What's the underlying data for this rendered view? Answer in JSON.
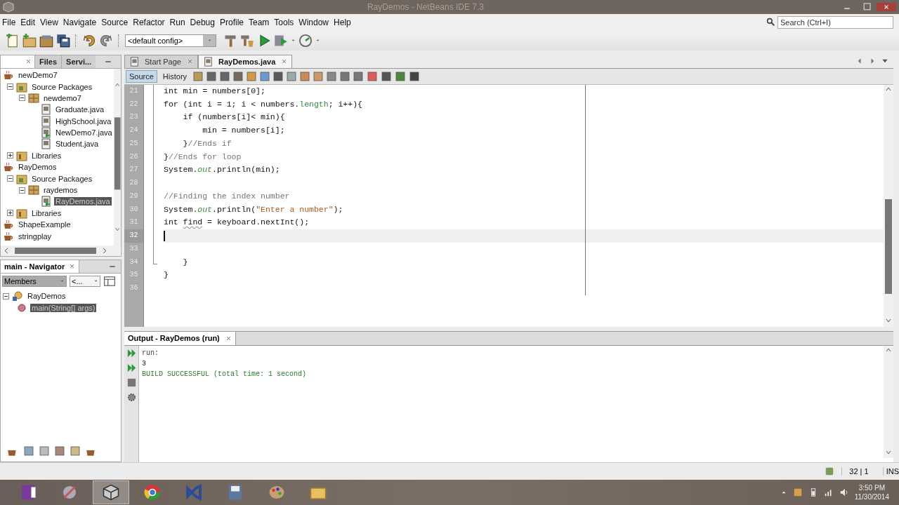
{
  "window": {
    "title": "RayDemos - NetBeans IDE 7.3"
  },
  "menu": [
    "File",
    "Edit",
    "View",
    "Navigate",
    "Source",
    "Refactor",
    "Run",
    "Debug",
    "Profile",
    "Team",
    "Tools",
    "Window",
    "Help"
  ],
  "search": {
    "placeholder": "Search (Ctrl+I)"
  },
  "toolbar": {
    "config": "<default config>"
  },
  "projects": {
    "tabs": [
      {
        "label": "Files",
        "selected": false
      },
      {
        "label": "Servi...",
        "selected": false
      }
    ],
    "tree": [
      {
        "label": "newDemo7",
        "kind": "project",
        "selected": false,
        "children": [
          {
            "label": "Source Packages",
            "kind": "sources",
            "expanded": true,
            "selected": false,
            "children": [
              {
                "label": "newdemo7",
                "kind": "package",
                "expanded": true,
                "selected": false,
                "children": [
                  {
                    "label": "Graduate.java",
                    "kind": "file",
                    "selected": false
                  },
                  {
                    "label": "HighSchool.java",
                    "kind": "file",
                    "selected": false
                  },
                  {
                    "label": "NewDemo7.java",
                    "kind": "mainfile",
                    "selected": false
                  },
                  {
                    "label": "Student.java",
                    "kind": "file",
                    "selected": false
                  }
                ]
              }
            ]
          },
          {
            "label": "Libraries",
            "kind": "libraries",
            "expanded": false,
            "selected": false
          }
        ]
      },
      {
        "label": "RayDemos",
        "kind": "project",
        "selected": false,
        "children": [
          {
            "label": "Source Packages",
            "kind": "sources",
            "expanded": true,
            "selected": false,
            "children": [
              {
                "label": "raydemos",
                "kind": "package",
                "expanded": true,
                "selected": false,
                "children": [
                  {
                    "label": "RayDemos.java",
                    "kind": "mainfile",
                    "selected": true
                  }
                ]
              }
            ]
          },
          {
            "label": "Libraries",
            "kind": "libraries",
            "expanded": false,
            "selected": false
          }
        ]
      },
      {
        "label": "ShapeExample",
        "kind": "project",
        "selected": false
      },
      {
        "label": "stringplay",
        "kind": "project",
        "selected": false
      }
    ]
  },
  "navigator": {
    "title": "main - Navigator",
    "filter": "Members",
    "view": "<...",
    "tree": [
      {
        "label": "RayDemos",
        "kind": "class",
        "expanded": true,
        "selected": false,
        "children": [
          {
            "label": "main(String[] args)",
            "kind": "method",
            "selected": true
          }
        ]
      }
    ]
  },
  "editor": {
    "tabs": [
      {
        "label": "Start Page",
        "selected": false
      },
      {
        "label": "RayDemos.java",
        "selected": true
      }
    ],
    "views": [
      {
        "label": "Source",
        "selected": true
      },
      {
        "label": "History",
        "selected": false
      }
    ],
    "lines": [
      {
        "number": "21",
        "current": false,
        "tokens": [
          {
            "text": "int min = numbers[0];",
            "kind": "plain"
          }
        ]
      },
      {
        "number": "22",
        "current": false,
        "tokens": [
          {
            "text": "for (int i = 1; i < numbers.",
            "kind": "plain"
          },
          {
            "text": "length",
            "kind": "field"
          },
          {
            "text": "; i++){",
            "kind": "plain"
          }
        ]
      },
      {
        "number": "23",
        "current": false,
        "tokens": [
          {
            "text": "    if (numbers[i]< min){",
            "kind": "plain"
          }
        ]
      },
      {
        "number": "24",
        "current": false,
        "tokens": [
          {
            "text": "        min = numbers[i];",
            "kind": "plain"
          }
        ]
      },
      {
        "number": "25",
        "current": false,
        "tokens": [
          {
            "text": "    }",
            "kind": "plain"
          },
          {
            "text": "//Ends if",
            "kind": "comment"
          }
        ]
      },
      {
        "number": "26",
        "current": false,
        "tokens": [
          {
            "text": "}",
            "kind": "plain"
          },
          {
            "text": "//Ends for loop",
            "kind": "comment"
          }
        ]
      },
      {
        "number": "27",
        "current": false,
        "tokens": [
          {
            "text": "System.",
            "kind": "plain"
          },
          {
            "text": "out",
            "kind": "static"
          },
          {
            "text": ".println(min);",
            "kind": "plain"
          }
        ]
      },
      {
        "number": "28",
        "current": false
      },
      {
        "number": "29",
        "current": false,
        "tokens": [
          {
            "text": "//Finding the index number",
            "kind": "comment"
          }
        ]
      },
      {
        "number": "30",
        "current": false,
        "tokens": [
          {
            "text": "System.",
            "kind": "plain"
          },
          {
            "text": "out",
            "kind": "static"
          },
          {
            "text": ".println(",
            "kind": "plain"
          },
          {
            "text": "\"Enter a number\"",
            "kind": "string"
          },
          {
            "text": ");",
            "kind": "plain"
          }
        ]
      },
      {
        "number": "31",
        "current": false,
        "tokens": [
          {
            "text": "int ",
            "kind": "plain"
          },
          {
            "text": "find",
            "kind": "warning"
          },
          {
            "text": " = keyboard.nextInt();",
            "kind": "plain"
          }
        ]
      },
      {
        "number": "32",
        "current": true
      },
      {
        "number": "33",
        "current": false
      },
      {
        "number": "34",
        "current": false,
        "tokens": [
          {
            "text": "    }",
            "kind": "plain"
          }
        ]
      },
      {
        "number": "35",
        "current": false,
        "tokens": [
          {
            "text": "}",
            "kind": "plain"
          }
        ]
      },
      {
        "number": "36",
        "current": false
      }
    ]
  },
  "output": {
    "title": "Output - RayDemos (run)",
    "lines": [
      {
        "text": "run:",
        "kind": "info"
      },
      {
        "text": "3",
        "kind": "stdout"
      },
      {
        "text": "BUILD SUCCESSFUL (total time: 1 second)",
        "kind": "success"
      }
    ]
  },
  "status_bar": {
    "position": "32 | 1",
    "mode": "INS"
  },
  "taskbar": {
    "apps": [
      {
        "selected": false
      },
      {
        "selected": false
      },
      {
        "selected": true
      },
      {
        "selected": false
      },
      {
        "selected": false
      },
      {
        "selected": false
      },
      {
        "selected": false
      },
      {
        "selected": false
      }
    ],
    "time": "3:50 PM",
    "date": "11/30/2014"
  }
}
